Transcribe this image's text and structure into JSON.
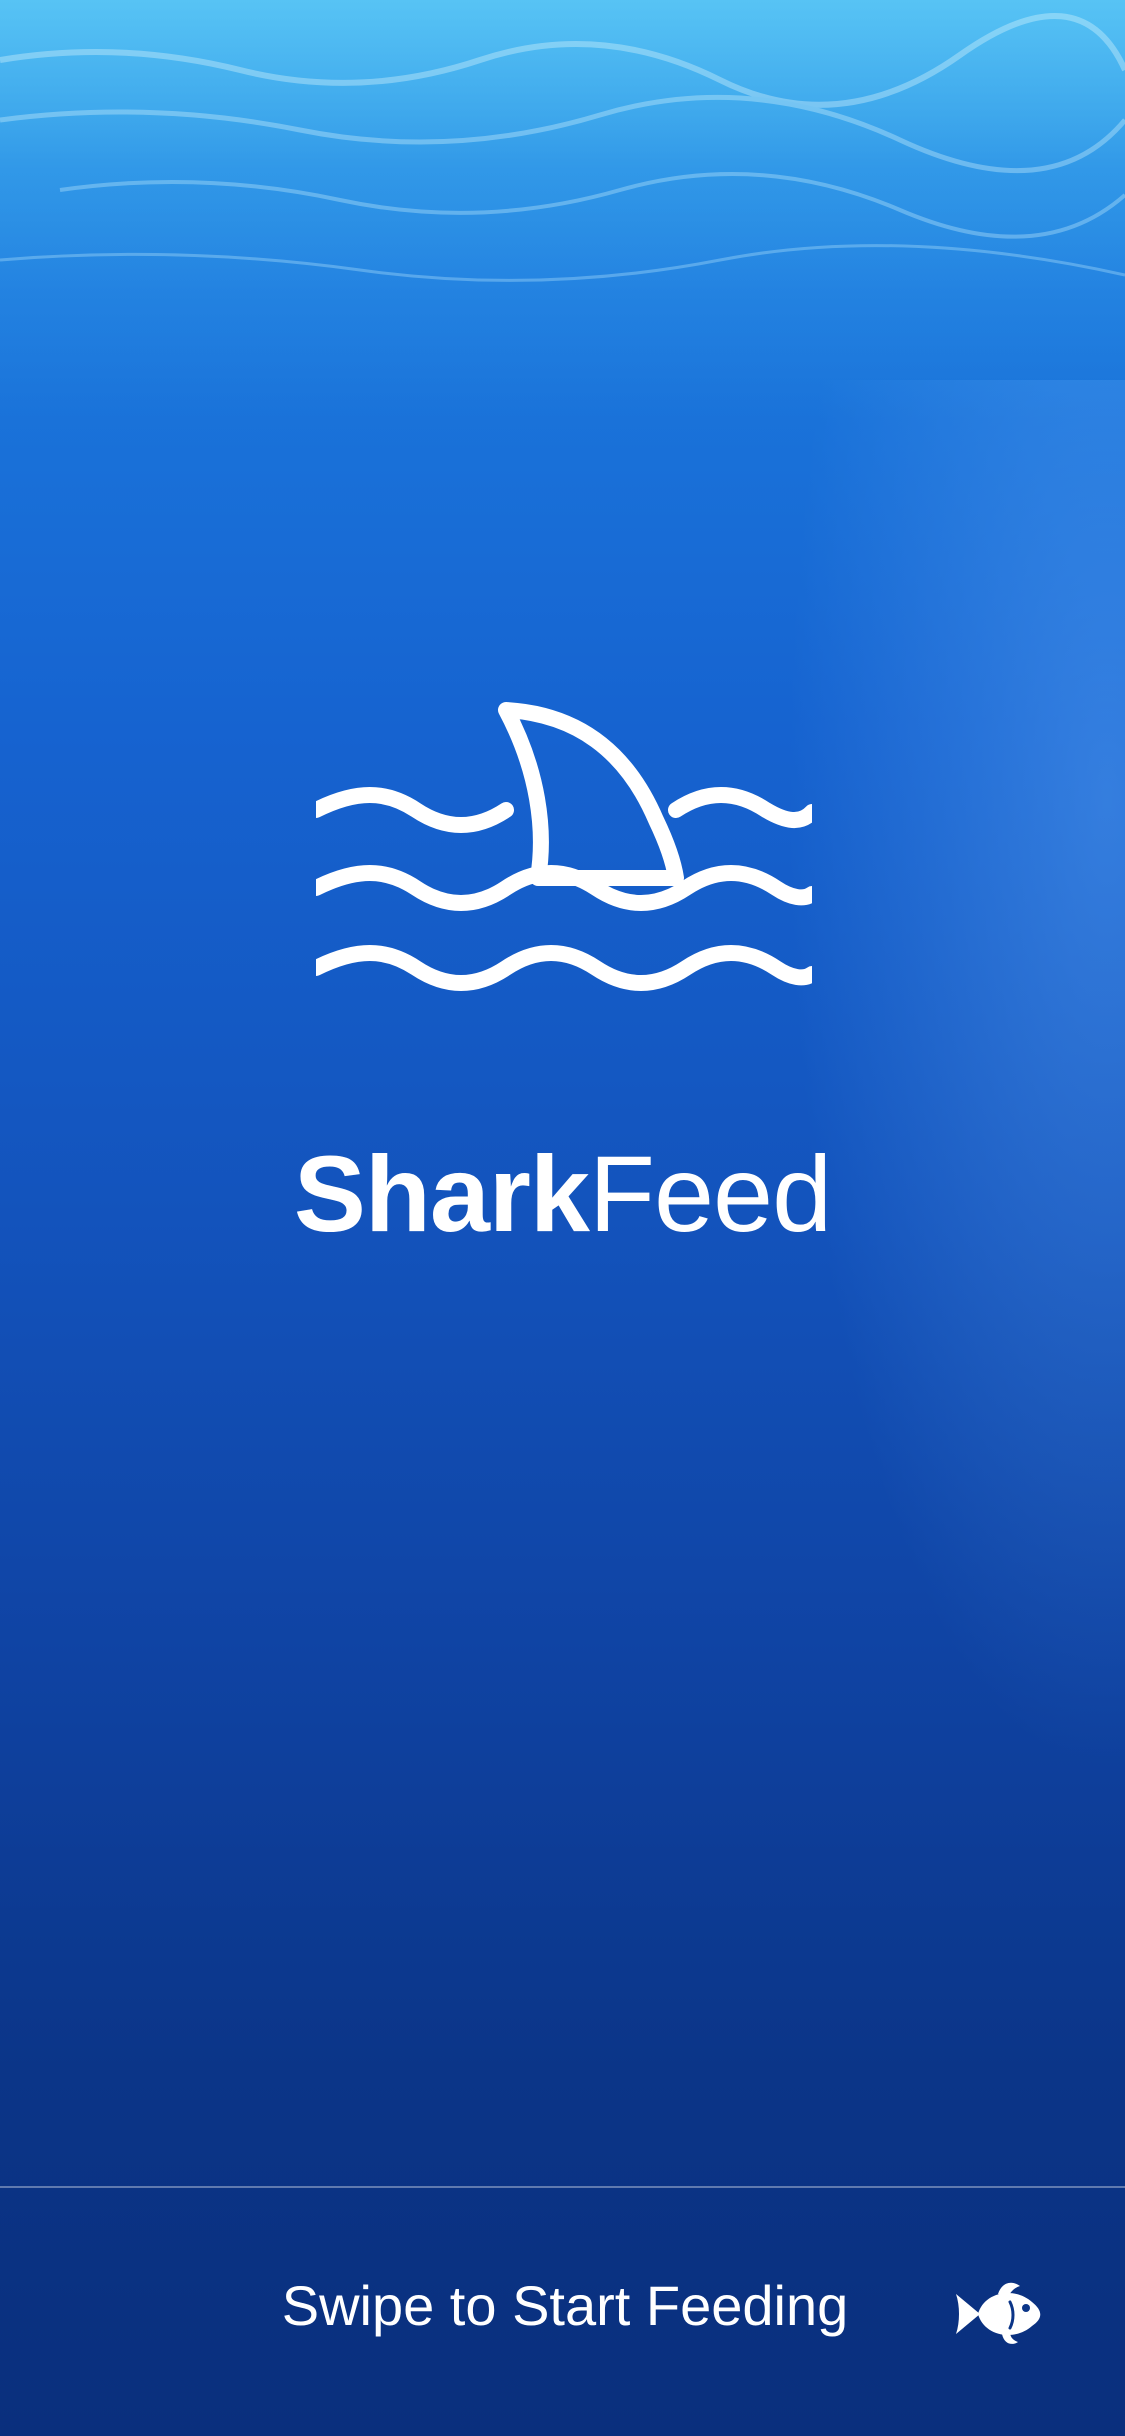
{
  "app": {
    "name_bold": "Shark",
    "name_light": "Feed"
  },
  "icons": {
    "logo": "shark-fin-waves-icon",
    "swipe_handle": "fish-icon"
  },
  "footer": {
    "swipe_label": "Swipe to Start Feeding"
  },
  "colors": {
    "background_top": "#2f9fe8",
    "background_bottom": "#0a2f7d",
    "foreground": "#ffffff"
  }
}
